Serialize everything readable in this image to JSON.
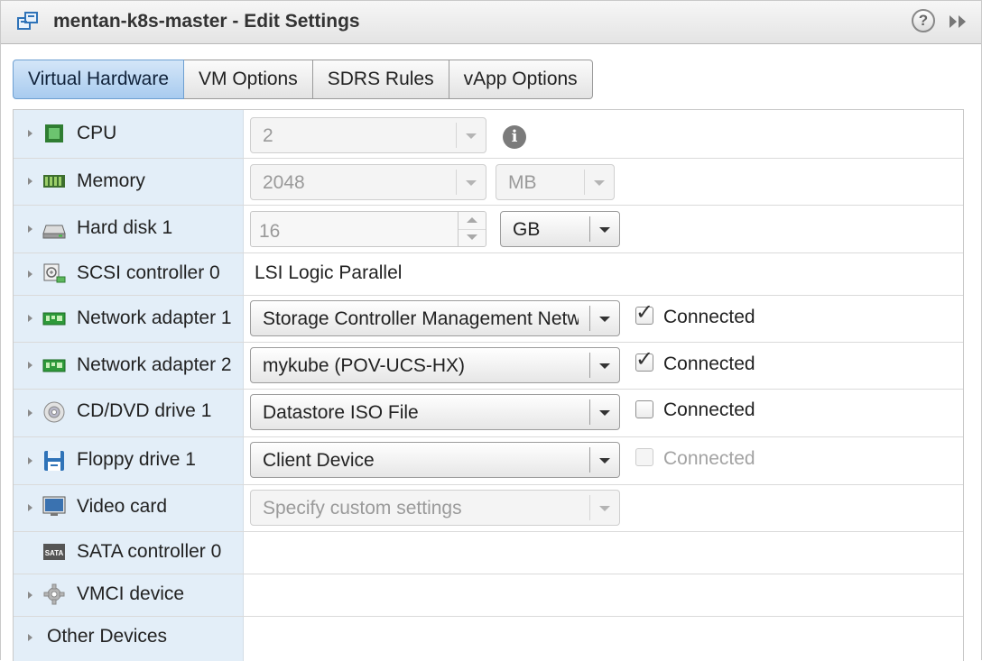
{
  "window": {
    "title": "mentan-k8s-master - Edit Settings",
    "help_glyph": "?"
  },
  "tabs": [
    {
      "label": "Virtual Hardware",
      "active": true
    },
    {
      "label": "VM Options",
      "active": false
    },
    {
      "label": "SDRS Rules",
      "active": false
    },
    {
      "label": "vApp Options",
      "active": false
    }
  ],
  "devices": {
    "cpu": {
      "label": "CPU",
      "value": "2",
      "info_glyph": "i"
    },
    "memory": {
      "label": "Memory",
      "value": "2048",
      "unit": "MB"
    },
    "hard_disk_1": {
      "label": "Hard disk 1",
      "value": "16",
      "unit": "GB"
    },
    "scsi_controller_0": {
      "label": "SCSI controller 0",
      "value": "LSI Logic Parallel"
    },
    "network_adapter_1": {
      "label": "Network adapter 1",
      "value": "Storage Controller Management Network",
      "connected_label": "Connected",
      "connected": true
    },
    "network_adapter_2": {
      "label": "Network adapter 2",
      "value": "mykube (POV-UCS-HX)",
      "connected_label": "Connected",
      "connected": true
    },
    "cd_dvd_drive_1": {
      "label": "CD/DVD drive 1",
      "value": "Datastore ISO File",
      "connected_label": "Connected",
      "connected": false
    },
    "floppy_drive_1": {
      "label": "Floppy drive 1",
      "value": "Client Device",
      "connected_label": "Connected",
      "connected": false,
      "connected_disabled": true
    },
    "video_card": {
      "label": "Video card",
      "value": "Specify custom settings"
    },
    "sata_controller_0": {
      "label": "SATA controller 0",
      "icon_text": "SATA"
    },
    "vmci_device": {
      "label": "VMCI device"
    },
    "other_devices": {
      "label": "Other Devices"
    }
  },
  "colors": {
    "active_tab": "#a8cbef",
    "label_column": "#e3eef8",
    "nic_icon": "#2e9a3a"
  }
}
